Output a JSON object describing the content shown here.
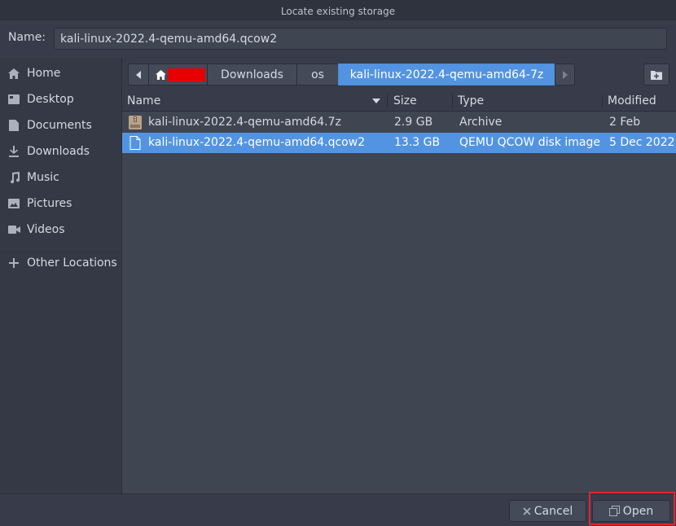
{
  "window": {
    "title": "Locate existing storage"
  },
  "namebar": {
    "label": "Name:",
    "value": "kali-linux-2022.4-qemu-amd64.qcow2"
  },
  "sidebar": {
    "items": [
      {
        "label": "Home",
        "icon": "home-icon"
      },
      {
        "label": "Desktop",
        "icon": "desktop-icon"
      },
      {
        "label": "Documents",
        "icon": "documents-icon"
      },
      {
        "label": "Downloads",
        "icon": "downloads-icon"
      },
      {
        "label": "Music",
        "icon": "music-icon"
      },
      {
        "label": "Pictures",
        "icon": "pictures-icon"
      },
      {
        "label": "Videos",
        "icon": "videos-icon"
      },
      {
        "label": "Other Locations",
        "icon": "plus-icon"
      }
    ]
  },
  "pathbar": {
    "crumbs": [
      "Downloads",
      "os",
      "kali-linux-2022.4-qemu-amd64-7z"
    ],
    "active_index": 2
  },
  "filelist": {
    "columns": {
      "name": "Name",
      "size": "Size",
      "type": "Type",
      "modified": "Modified"
    },
    "rows": [
      {
        "name": "kali-linux-2022.4-qemu-amd64.7z",
        "size": "2.9 GB",
        "type": "Archive",
        "modified": "2 Feb",
        "selected": false,
        "icon": "archive-icon"
      },
      {
        "name": "kali-linux-2022.4-qemu-amd64.qcow2",
        "size": "13.3 GB",
        "type": "QEMU QCOW disk image",
        "modified": "5 Dec 2022",
        "selected": true,
        "icon": "file-icon"
      }
    ]
  },
  "actions": {
    "cancel_label": "Cancel",
    "open_label": "Open"
  },
  "colors": {
    "accent": "#5294e2",
    "highlight": "#e0282e",
    "redaction": "#e60000"
  }
}
